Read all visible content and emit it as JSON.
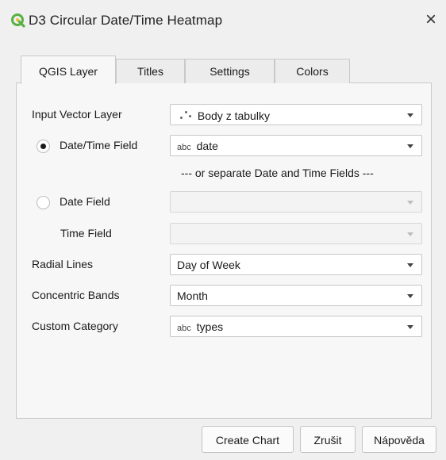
{
  "window": {
    "title": "D3 Circular Date/Time Heatmap",
    "close_symbol": "×",
    "app_icon": "qgis-logo-icon",
    "accent_color": "#59b044"
  },
  "tabs": [
    {
      "label": "QGIS Layer",
      "active": true
    },
    {
      "label": "Titles",
      "active": false
    },
    {
      "label": "Settings",
      "active": false
    },
    {
      "label": "Colors",
      "active": false
    }
  ],
  "form": {
    "input_vector_layer": {
      "label": "Input Vector Layer",
      "value": "Body z tabulky",
      "icon": "point-layer-icon"
    },
    "datetime_field": {
      "label": "Date/Time Field",
      "selected": true,
      "type_tag": "abc",
      "value": "date"
    },
    "separator_text": "--- or separate Date and Time Fields ---",
    "date_field": {
      "label": "Date Field",
      "selected": false,
      "value": ""
    },
    "time_field": {
      "label": "Time Field",
      "value": ""
    },
    "radial_lines": {
      "label": "Radial Lines",
      "value": "Day of Week"
    },
    "concentric_bands": {
      "label": "Concentric Bands",
      "value": "Month"
    },
    "custom_category": {
      "label": "Custom Category",
      "type_tag": "abc",
      "value": "types"
    }
  },
  "buttons": {
    "create_chart": "Create Chart",
    "cancel": "Zrušit",
    "help": "Nápověda"
  }
}
